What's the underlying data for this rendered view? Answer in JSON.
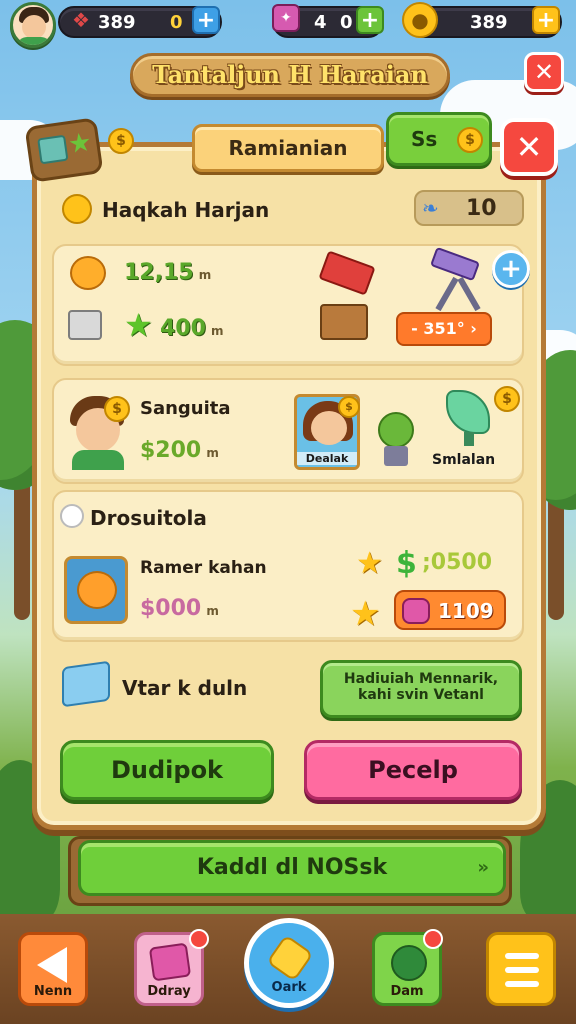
{
  "topbar": {
    "resources": [
      {
        "value": "389",
        "extra": "0",
        "icon": "gem-icon",
        "plus": "+"
      },
      {
        "value": "4",
        "extra": "0",
        "icon": "card-icon",
        "plus": "+"
      },
      {
        "value": "389",
        "extra": "",
        "icon": "coin-icon",
        "plus": "+"
      }
    ]
  },
  "header": {
    "title": "Tantaljun H Haraian",
    "close": "✕"
  },
  "tabs": {
    "main": "Ramianian",
    "secondary": "Ss"
  },
  "close_inner": "✕",
  "daily": {
    "label": "Haqkah Harjan",
    "count": "10"
  },
  "card1": {
    "value1": "12,15",
    "value2": "400",
    "unit": "m",
    "price": "- 351° ›"
  },
  "card2": {
    "name": "Sanguita",
    "amount": "$200",
    "unit": "m",
    "item1": "Dealak",
    "item2": "Smlalan"
  },
  "card3": {
    "title": "Drosuitola",
    "item_name": "Ramer kahan",
    "amount": "$000",
    "unit": "m",
    "reward1": ";0500",
    "reward2": "1109"
  },
  "hint": {
    "label": "Vtar k duln",
    "button_line1": "Hadiuiah Mennarik,",
    "button_line2": "kahi svin Vetanl"
  },
  "buttons": {
    "left": "Dudipok",
    "right": "Pecelp",
    "bottom": "Kaddl dl NOSsk",
    "chevron": "»"
  },
  "nav": {
    "back": "Nenn",
    "daily": "Ddray",
    "center": "Oark",
    "dam": "Dam"
  },
  "colors": {
    "panel": "#f6e1a6",
    "panel_border": "#b47a36",
    "green": "#6fcf3a",
    "pink": "#ff6ba0",
    "close_red": "#f5483f"
  }
}
